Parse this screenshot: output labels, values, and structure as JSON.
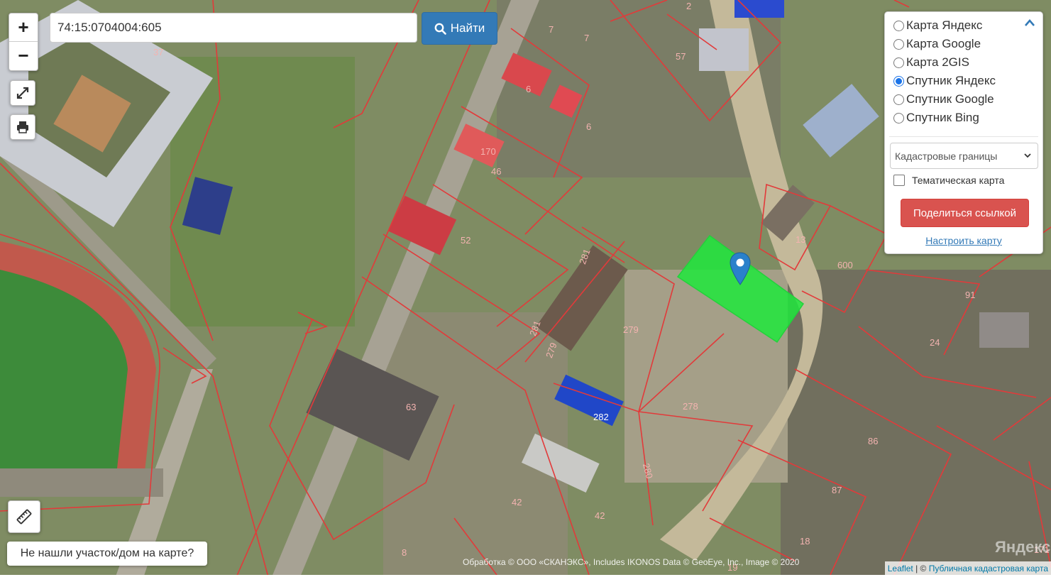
{
  "search": {
    "value": "74:15:0704004:605",
    "button_label": "Найти"
  },
  "zoom": {
    "in_label": "+",
    "out_label": "−"
  },
  "layers": {
    "options": [
      {
        "label": "Карта Яндекс",
        "selected": false
      },
      {
        "label": "Карта Google",
        "selected": false
      },
      {
        "label": "Карта 2GIS",
        "selected": false
      },
      {
        "label": "Спутник Яндекс",
        "selected": true
      },
      {
        "label": "Спутник Google",
        "selected": false
      },
      {
        "label": "Спутник Bing",
        "selected": false
      }
    ],
    "overlay_select": "Кадастровые границы",
    "thematic_label": "Тематическая карта",
    "thematic_checked": false,
    "share_label": "Поделиться ссылкой",
    "configure_label": "Настроить карту"
  },
  "notfound_label": "Не нашли участок/дом на карте?",
  "attribution": {
    "imagery": "Обработка © ООО «СКАНЭКС», Includes IKONOS Data © GeoEye, Inc., Image © 2020",
    "leaflet": "Leaflet",
    "separator": " | © ",
    "cadastre": "Публичная кадастровая карта"
  },
  "watermark": "Яндекс",
  "parcel_labels": [
    "37",
    "7",
    "7",
    "57",
    "6",
    "6",
    "170",
    "46",
    "52",
    "281",
    "279",
    "281",
    "279",
    "13",
    "600",
    "91",
    "24",
    "63",
    "282",
    "278",
    "280",
    "42",
    "42",
    "8",
    "19",
    "18",
    "87",
    "86",
    "171",
    "2"
  ],
  "colors": {
    "boundary": "#e23a3a",
    "selected_parcel": "#1ee83c",
    "marker": "#2a81cb",
    "search_button": "#337ab7",
    "share_button": "#d9534f"
  }
}
